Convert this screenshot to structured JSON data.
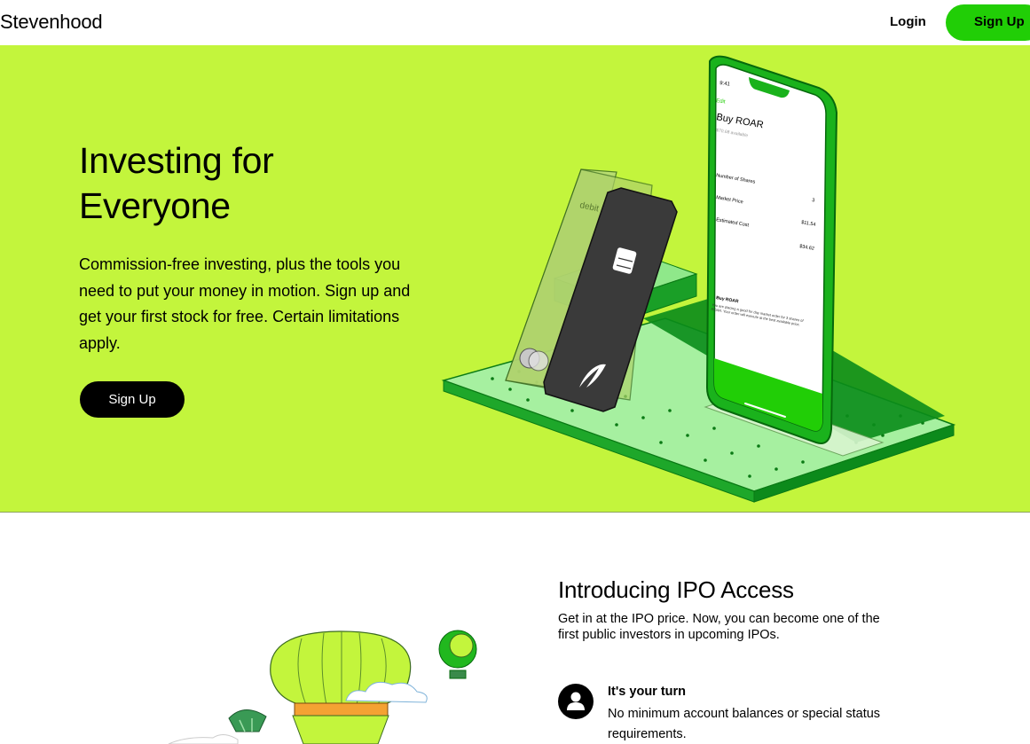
{
  "header": {
    "brand": "Stevenhood",
    "login_label": "Login",
    "signup_label": "Sign Up"
  },
  "hero": {
    "title_line1": "Investing for",
    "title_line2": "Everyone",
    "subtitle": "Commission-free investing, plus the tools you need to put your money in motion. Sign up and get your first stock for free. Certain limitations apply.",
    "cta_label": "Sign Up",
    "phone": {
      "time": "9:41",
      "edit_label": "Edit",
      "buy_title": "Buy ROAR",
      "buying_power": "$70.68 available",
      "shares_label": "Number of Shares",
      "shares_value": "3",
      "market_price_label": "Market Price",
      "market_price_value": "$11.54",
      "estimated_cost_label": "Estimated Cost",
      "estimated_cost_value": "$34.62",
      "note_title": "Buy ROAR",
      "note_text": "You are placing a good for day market order for 3 shares of ROAR. Your order will execute at the best available price.",
      "swipe_label": "Swipe Up To Submit"
    },
    "card": {
      "debit_label": "debit"
    }
  },
  "ipo": {
    "title": "Introducing IPO Access",
    "description": "Get in at the IPO price. Now, you can become one of the first public investors in upcoming IPOs.",
    "feature_title": "It's your turn",
    "feature_desc": "No minimum account balances or special status requirements."
  },
  "colors": {
    "hero_bg": "#c3f53c",
    "brand_green": "#21ce06",
    "dark": "#000000"
  },
  "icons": [
    "person-icon",
    "robinhood-feather-icon",
    "card-chip-icon"
  ]
}
